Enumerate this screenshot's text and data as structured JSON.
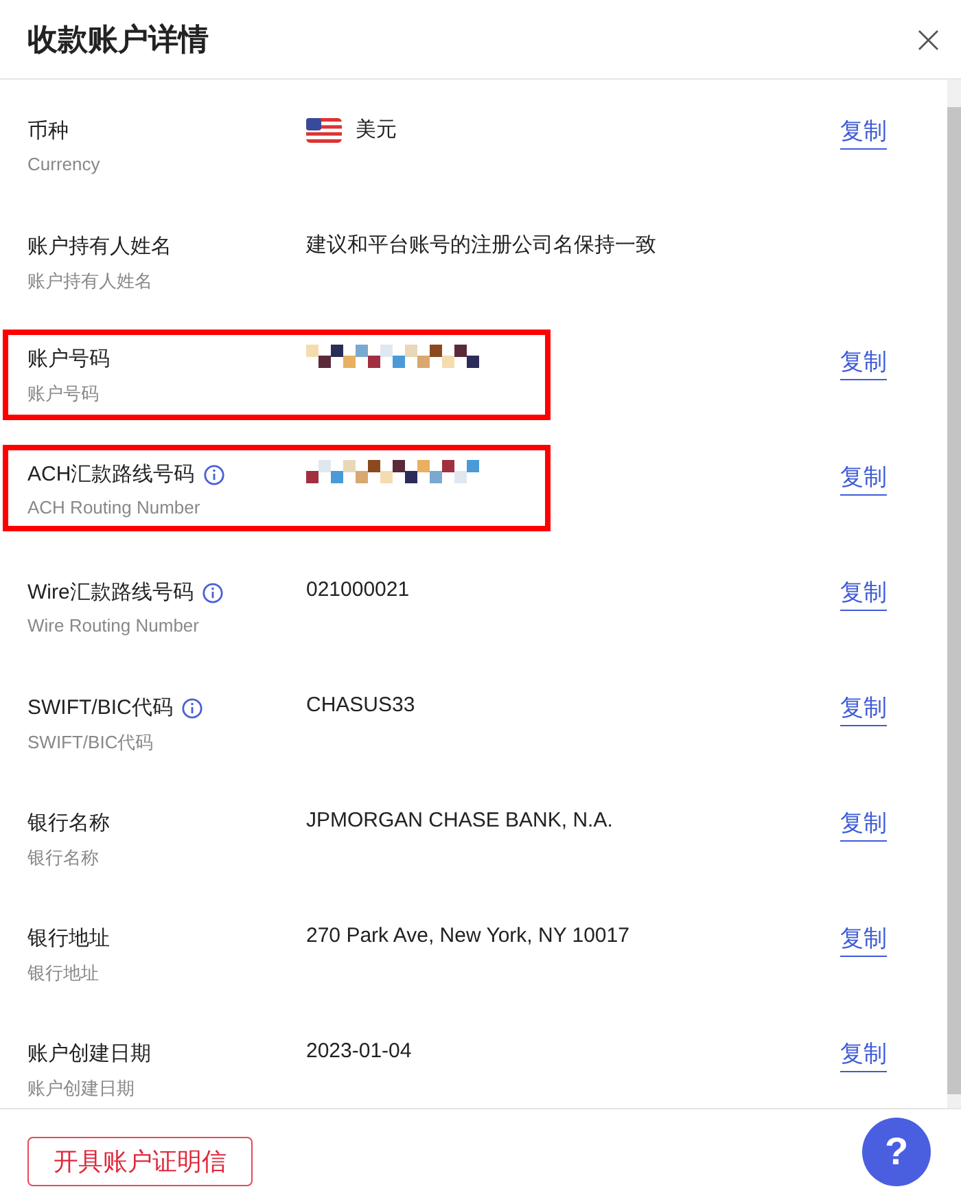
{
  "dialog": {
    "title": "收款账户详情",
    "close": "×"
  },
  "rows": [
    {
      "label": "币种",
      "sublabel": "Currency",
      "value": {
        "kind": "currency",
        "text": "美元"
      },
      "action": "复制"
    },
    {
      "label": "账户持有人姓名",
      "sublabel": "账户持有人姓名",
      "value": {
        "kind": "text",
        "text": "建议和平台账号的注册公司名保持一致"
      }
    },
    {
      "label": "账户号码",
      "sublabel": "账户号码",
      "highlighted": true,
      "value": {
        "kind": "redacted"
      },
      "action": "复制"
    },
    {
      "label": "ACH汇款路线号码",
      "sublabel": "ACH Routing Number",
      "info": true,
      "highlighted": true,
      "value": {
        "kind": "redacted"
      },
      "action": "复制"
    },
    {
      "label": "Wire汇款路线号码",
      "sublabel": "Wire Routing Number",
      "info": true,
      "value": {
        "kind": "text",
        "text": "021000021"
      },
      "action": "复制"
    },
    {
      "label": "SWIFT/BIC代码",
      "sublabel": "SWIFT/BIC代码",
      "info": true,
      "value": {
        "kind": "text",
        "text": "CHASUS33"
      },
      "action": "复制"
    },
    {
      "label": "银行名称",
      "sublabel": "银行名称",
      "value": {
        "kind": "text",
        "text": "JPMORGAN CHASE BANK, N.A."
      },
      "action": "复制"
    },
    {
      "label": "银行地址",
      "sublabel": "银行地址",
      "value": {
        "kind": "text",
        "text": "270 Park Ave, New York, NY 10017"
      },
      "action": "复制"
    },
    {
      "label": "账户创建日期",
      "sublabel": "账户创建日期",
      "value": {
        "kind": "text",
        "text": "2023-01-04"
      },
      "action": "复制"
    }
  ],
  "footer": {
    "button": "开具账户证明信",
    "help": "?"
  }
}
